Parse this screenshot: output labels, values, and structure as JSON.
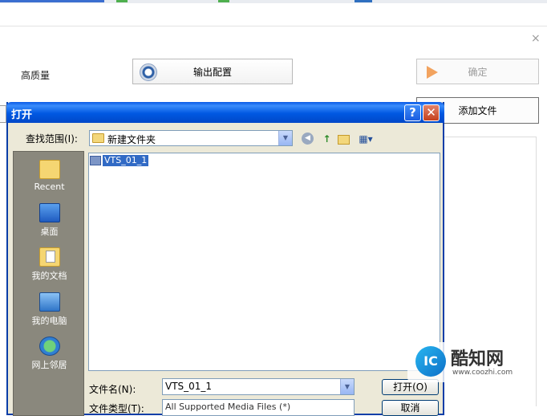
{
  "app": {
    "quality_label": "高质量",
    "output_config_label": "输出配置",
    "confirm_label": "确定",
    "add_file_label": "添加文件",
    "close_glyph": "×"
  },
  "dialog": {
    "title": "打开",
    "help_glyph": "?",
    "close_glyph": "✕",
    "look_in_label": "查找范围(I):",
    "look_in_value": "新建文件夹",
    "places": [
      {
        "label": "Recent",
        "icon": "recent-folder-icon"
      },
      {
        "label": "桌面",
        "icon": "desktop-icon"
      },
      {
        "label": "我的文档",
        "icon": "my-documents-icon"
      },
      {
        "label": "我的电脑",
        "icon": "my-computer-icon"
      },
      {
        "label": "网上邻居",
        "icon": "network-places-icon"
      }
    ],
    "files": [
      {
        "name": "VTS_01_1",
        "selected": true
      }
    ],
    "file_name_label": "文件名(N):",
    "file_name_value": "VTS_01_1",
    "file_type_label": "文件类型(T):",
    "file_type_value": "All Supported Media Files (*)",
    "open_label": "打开(O)",
    "cancel_label": "取消"
  },
  "watermark": {
    "logo_text": "IC",
    "name": "酷知网",
    "url": "www.coozhi.com"
  },
  "colors": {
    "titlebar": "#0058e2",
    "dialog_bg": "#ece9d8",
    "selection": "#316ac5",
    "places_bg": "#8a887d"
  }
}
